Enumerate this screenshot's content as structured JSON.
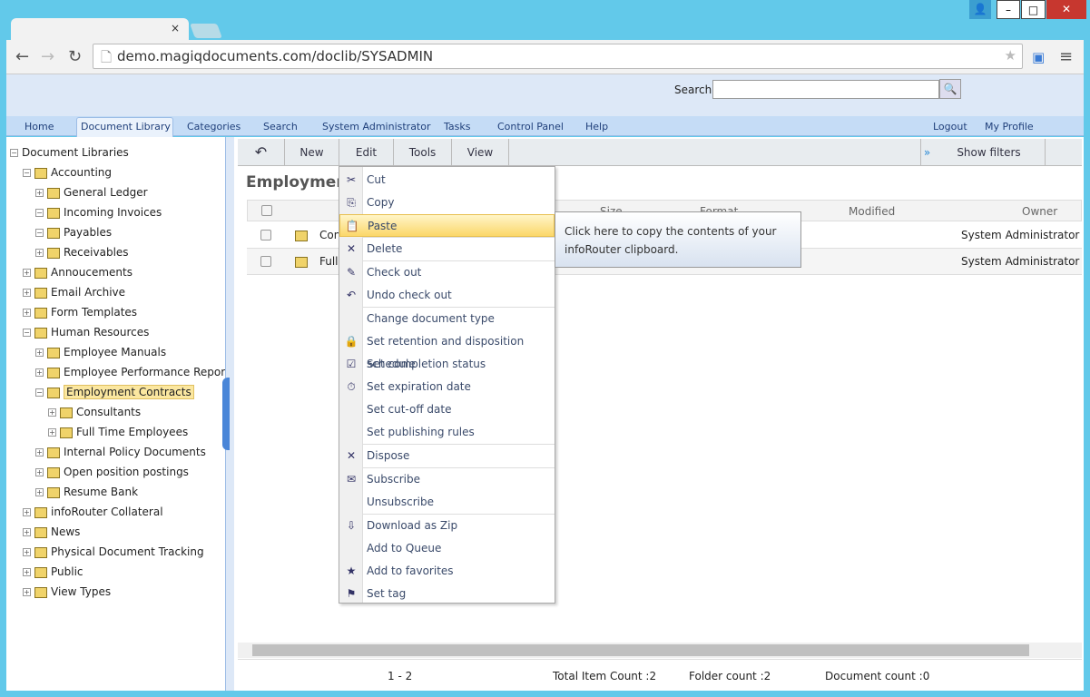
{
  "browser": {
    "url": "demo.magiqdocuments.com/doclib/SYSADMIN",
    "tab_close": "×"
  },
  "header": {
    "search_label": "Search:",
    "search_value": ""
  },
  "nav": {
    "items": [
      "Home",
      "Document Library",
      "Categories",
      "Search",
      "System Administrator",
      "Tasks",
      "Control Panel",
      "Help"
    ],
    "right": [
      "Logout",
      "My Profile"
    ]
  },
  "tree": [
    {
      "label": "Document Libraries",
      "level": 0,
      "pm": "−",
      "folder": false
    },
    {
      "label": "Accounting",
      "level": 1,
      "pm": "−"
    },
    {
      "label": "General Ledger",
      "level": 2,
      "pm": "+"
    },
    {
      "label": "Incoming Invoices",
      "level": 2,
      "pm": "−"
    },
    {
      "label": "Payables",
      "level": 2,
      "pm": "−"
    },
    {
      "label": "Receivables",
      "level": 2,
      "pm": "+"
    },
    {
      "label": "Annoucements",
      "level": 1,
      "pm": "+"
    },
    {
      "label": "Email Archive",
      "level": 1,
      "pm": "+"
    },
    {
      "label": "Form Templates",
      "level": 1,
      "pm": "+"
    },
    {
      "label": "Human Resources",
      "level": 1,
      "pm": "−"
    },
    {
      "label": "Employee Manuals",
      "level": 2,
      "pm": "+"
    },
    {
      "label": "Employee Performance Reports",
      "level": 2,
      "pm": "+"
    },
    {
      "label": "Employment Contracts",
      "level": 2,
      "pm": "−",
      "selected": true
    },
    {
      "label": "Consultants",
      "level": 3,
      "pm": "+"
    },
    {
      "label": "Full Time Employees",
      "level": 3,
      "pm": "+"
    },
    {
      "label": "Internal Policy Documents",
      "level": 2,
      "pm": "+"
    },
    {
      "label": "Open position postings",
      "level": 2,
      "pm": "+"
    },
    {
      "label": "Resume Bank",
      "level": 2,
      "pm": "+"
    },
    {
      "label": "infoRouter Collateral",
      "level": 1,
      "pm": "+"
    },
    {
      "label": "News",
      "level": 1,
      "pm": "+"
    },
    {
      "label": "Physical Document Tracking",
      "level": 1,
      "pm": "+"
    },
    {
      "label": "Public",
      "level": 1,
      "pm": "+"
    },
    {
      "label": "View Types",
      "level": 1,
      "pm": "+"
    }
  ],
  "toolbar": {
    "back": "↶",
    "new": "New",
    "edit": "Edit",
    "tools": "Tools",
    "view": "View",
    "show_filters": "Show filters",
    "filter_chevron": "»"
  },
  "main": {
    "title": "Employment Contracts",
    "columns": [
      "Size",
      "Format",
      "Modified",
      "Owner"
    ],
    "rows": [
      {
        "name": "Consultants",
        "owner": "System Administrator"
      },
      {
        "name": "Full Time Employees",
        "owner": "System Administrator"
      }
    ]
  },
  "menu": {
    "items": [
      {
        "label": "Cut",
        "icon": "✂"
      },
      {
        "label": "Copy",
        "icon": "⎘"
      },
      {
        "label": "Paste",
        "icon": "📋",
        "highlight": true,
        "sep": true
      },
      {
        "label": "Delete",
        "icon": "✕",
        "sep": true
      },
      {
        "label": "Check out",
        "icon": "✎"
      },
      {
        "label": "Undo check out",
        "icon": "↶",
        "sep": true
      },
      {
        "label": "Change document type",
        "icon": ""
      },
      {
        "label": "Set retention and disposition schedule",
        "icon": "🔒"
      },
      {
        "label": "Set completion status",
        "icon": "☑"
      },
      {
        "label": "Set expiration date",
        "icon": "⏱"
      },
      {
        "label": "Set cut-off date",
        "icon": ""
      },
      {
        "label": "Set publishing rules",
        "icon": "",
        "sep": true
      },
      {
        "label": "Dispose",
        "icon": "✕",
        "sep": true
      },
      {
        "label": "Subscribe",
        "icon": "✉"
      },
      {
        "label": "Unsubscribe",
        "icon": "",
        "sep": true
      },
      {
        "label": "Download as Zip",
        "icon": "⇩"
      },
      {
        "label": "Add to Queue",
        "icon": ""
      },
      {
        "label": "Add to favorites",
        "icon": "★"
      },
      {
        "label": "Set tag",
        "icon": "⚑"
      }
    ]
  },
  "tooltip": "Click here to copy the contents of your infoRouter clipboard.",
  "footer": {
    "range": "1 - 2",
    "total": "Total Item Count :2",
    "folders": "Folder count :2",
    "documents": "Document count :0"
  }
}
